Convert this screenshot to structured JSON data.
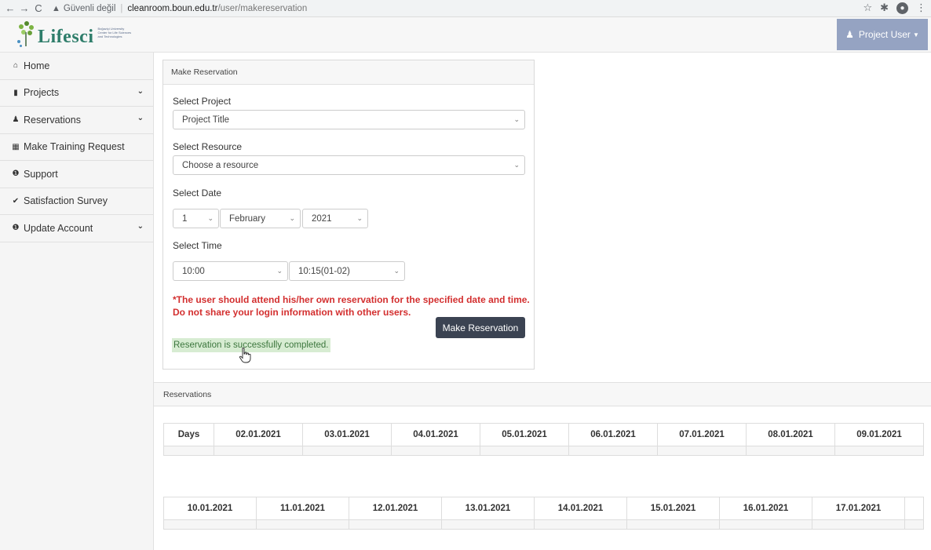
{
  "browser": {
    "security_text": "Güvenli değil",
    "url_host": "cleanroom.boun.edu.tr",
    "url_path": "/user/makereservation"
  },
  "header": {
    "logo_text": "Lifesci",
    "logo_sub_1": "Boğaziçi University",
    "logo_sub_2": "Center for Life Sciences",
    "logo_sub_3": "and Technologies",
    "user_label": "Project User"
  },
  "sidebar": {
    "items": [
      {
        "label": "Home",
        "icon": "home-icon",
        "has_chevron": false
      },
      {
        "label": "Projects",
        "icon": "folder-icon",
        "has_chevron": true
      },
      {
        "label": "Reservations",
        "icon": "user-icon",
        "has_chevron": true
      },
      {
        "label": "Make Training Request",
        "icon": "calendar-icon",
        "has_chevron": false
      },
      {
        "label": "Support",
        "icon": "info-icon",
        "has_chevron": false
      },
      {
        "label": "Satisfaction Survey",
        "icon": "check-circle-icon",
        "has_chevron": false
      },
      {
        "label": "Update Account",
        "icon": "info-icon",
        "has_chevron": true
      }
    ]
  },
  "form": {
    "title": "Make Reservation",
    "project_label": "Select Project",
    "project_value": "Project Title",
    "resource_label": "Select Resource",
    "resource_value": "Choose a resource",
    "date_label": "Select Date",
    "day_value": "1",
    "month_value": "February",
    "year_value": "2021",
    "time_label": "Select Time",
    "start_time_value": "10:00",
    "end_time_value": "10:15(01-02)",
    "warning_line_1": "*The user should attend his/her own reservation for the specified date and time.",
    "warning_line_2": "Do not share your login information with other users.",
    "submit_label": "Make Reservation",
    "success_message": "Reservation is successfully completed."
  },
  "reservations": {
    "title": "Reservations",
    "table1_headers": [
      "Days",
      "02.01.2021",
      "03.01.2021",
      "04.01.2021",
      "05.01.2021",
      "06.01.2021",
      "07.01.2021",
      "08.01.2021",
      "09.01.2021"
    ],
    "table2_headers": [
      "10.01.2021",
      "11.01.2021",
      "12.01.2021",
      "13.01.2021",
      "14.01.2021",
      "15.01.2021",
      "16.01.2021",
      "17.01.2021",
      ""
    ]
  }
}
